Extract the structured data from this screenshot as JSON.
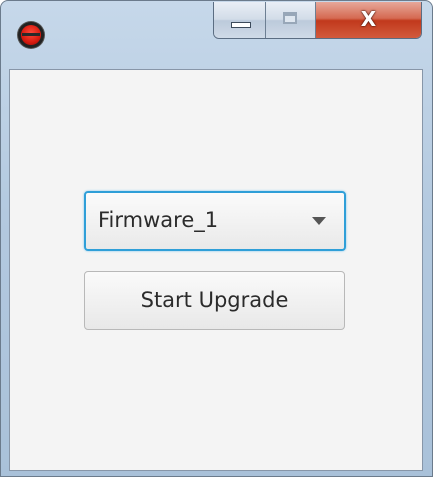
{
  "window": {
    "title": "",
    "controls": {
      "close_label": "X"
    }
  },
  "form": {
    "firmware_select": {
      "selected": "Firmware_1"
    },
    "start_button_label": "Start Upgrade"
  },
  "colors": {
    "focus_border": "#2f9fd8",
    "close_button": "#c1391c",
    "client_background": "#f4f4f4"
  },
  "icons": {
    "app": "app-logo-icon",
    "minimize": "minimize-icon",
    "maximize": "maximize-icon",
    "close": "close-icon",
    "dropdown": "chevron-down-icon"
  }
}
